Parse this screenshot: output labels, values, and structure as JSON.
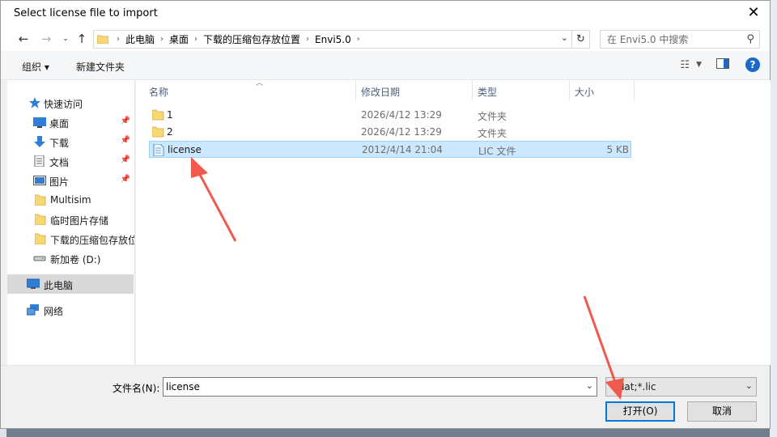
{
  "dialog": {
    "title": "Select license file to import"
  },
  "nav": {
    "back_icon": "arrow-left-icon",
    "forward_icon": "arrow-right-icon",
    "recent_icon": "chevron-down-icon",
    "up_icon": "arrow-up-icon"
  },
  "address": {
    "crumbs": [
      "此电脑",
      "桌面",
      "下载的压缩包存放位置",
      "Envi5.0"
    ]
  },
  "search": {
    "placeholder": "在 Envi5.0 中搜索"
  },
  "toolbar": {
    "organize": "组织 ▾",
    "new_folder": "新建文件夹",
    "help": "?"
  },
  "sidebar": {
    "items": [
      {
        "label": "快速访问",
        "icon": "star-icon"
      },
      {
        "label": "桌面",
        "icon": "desktop-icon",
        "pinned": true
      },
      {
        "label": "下载",
        "icon": "download-icon",
        "pinned": true
      },
      {
        "label": "文档",
        "icon": "document-icon",
        "pinned": true
      },
      {
        "label": "图片",
        "icon": "picture-icon",
        "pinned": true
      },
      {
        "label": "Multisim",
        "icon": "folder-icon"
      },
      {
        "label": "临时图片存储",
        "icon": "folder-icon"
      },
      {
        "label": "下载的压缩包存放位",
        "icon": "folder-icon"
      },
      {
        "label": "新加卷 (D:)",
        "icon": "drive-icon"
      },
      {
        "label": "此电脑",
        "icon": "computer-icon",
        "selected": true
      },
      {
        "label": "网络",
        "icon": "network-icon"
      }
    ]
  },
  "columns": {
    "name": "名称",
    "date": "修改日期",
    "type": "类型",
    "size": "大小"
  },
  "files": [
    {
      "name": "1",
      "date": "2026/4/12 13:29",
      "type": "文件夹",
      "size": ""
    },
    {
      "name": "2",
      "date": "2026/4/12 13:29",
      "type": "文件夹",
      "size": ""
    },
    {
      "name": "license",
      "date": "2012/4/14 21:04",
      "type": "LIC 文件",
      "size": "5 KB",
      "selected": true
    }
  ],
  "bottom": {
    "filename_label": "文件名(N):",
    "filename_value": "license",
    "filetype_value": "*.dat;*.lic",
    "open_label": "打开(O)",
    "cancel_label": "取消"
  },
  "colors": {
    "accent": "#0078d7",
    "selection": "#cce8ff",
    "annotation_arrow": "#f05a4e"
  }
}
